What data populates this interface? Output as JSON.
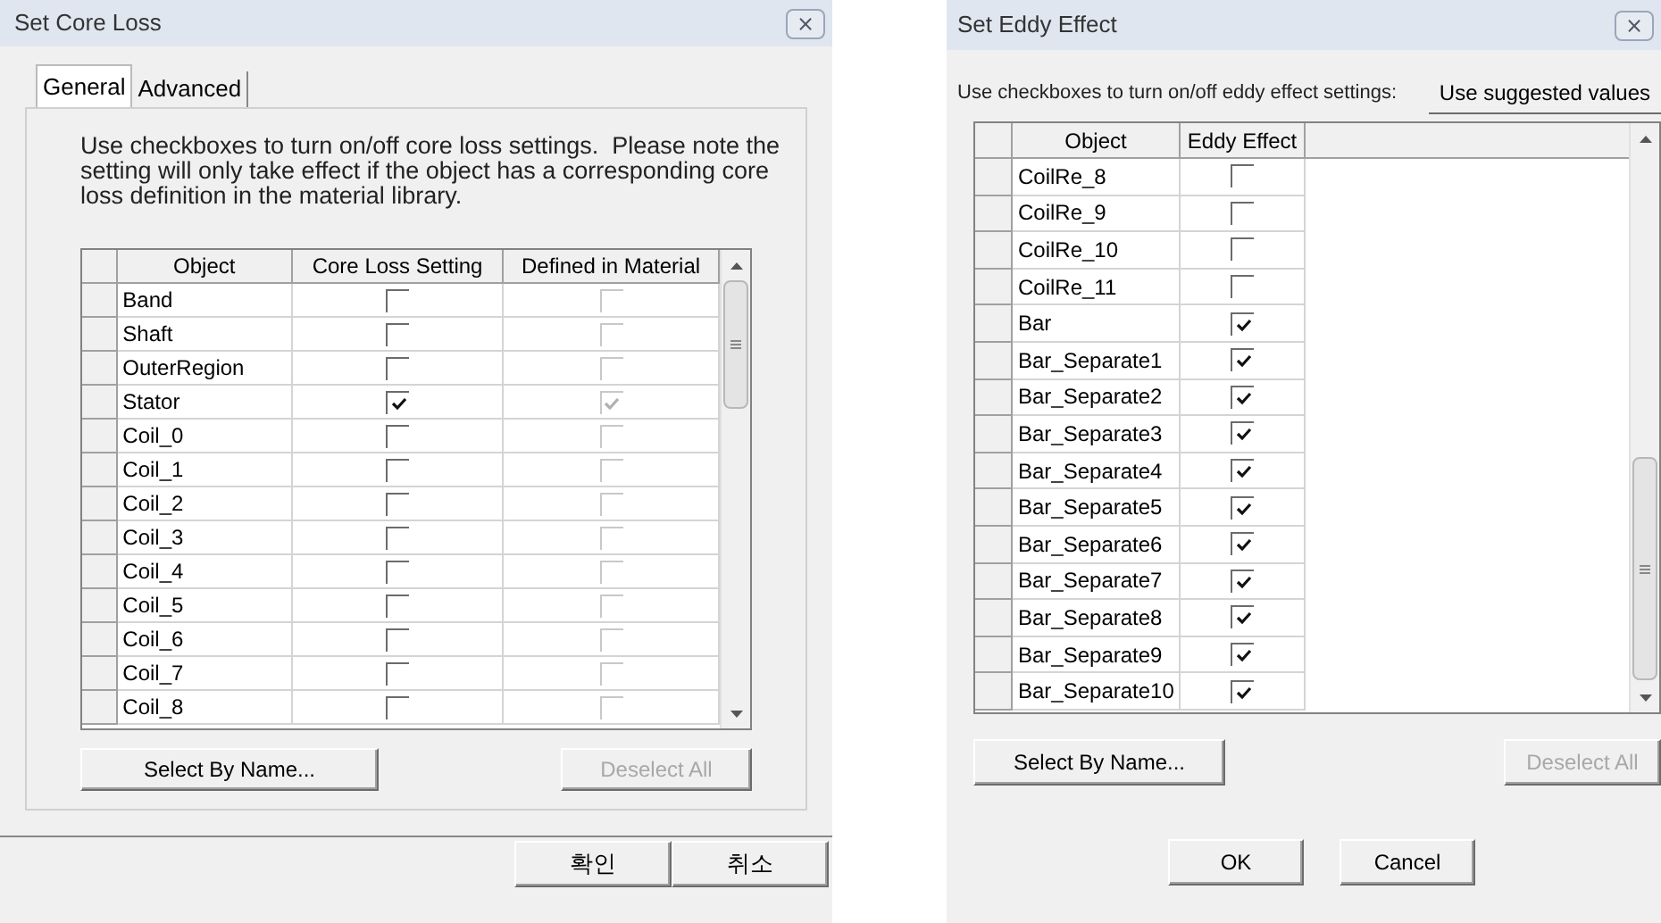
{
  "core_loss_dialog": {
    "title": "Set Core Loss",
    "close": "⨯",
    "tabs": [
      {
        "label": "General",
        "selected": true
      },
      {
        "label": "Advanced",
        "selected": false
      }
    ],
    "instructions": "Use checkboxes to turn on/off core loss settings.  Please note the setting will only take effect if the object has a corresponding core loss definition in the material library.",
    "table": {
      "columns": [
        {
          "label": "Object",
          "kind": "text"
        },
        {
          "label": "Core Loss Setting",
          "kind": "checkbox",
          "disabled": false
        },
        {
          "label": "Defined in Material",
          "kind": "checkbox",
          "disabled": true
        }
      ],
      "rows": [
        {
          "object": "Band",
          "checks": [
            {
              "checked": false
            },
            {
              "checked": false
            }
          ]
        },
        {
          "object": "Shaft",
          "checks": [
            {
              "checked": false
            },
            {
              "checked": false
            }
          ]
        },
        {
          "object": "OuterRegion",
          "checks": [
            {
              "checked": false
            },
            {
              "checked": false
            }
          ]
        },
        {
          "object": "Stator",
          "checks": [
            {
              "checked": true
            },
            {
              "checked": true
            }
          ]
        },
        {
          "object": "Coil_0",
          "checks": [
            {
              "checked": false
            },
            {
              "checked": false
            }
          ]
        },
        {
          "object": "Coil_1",
          "checks": [
            {
              "checked": false
            },
            {
              "checked": false
            }
          ]
        },
        {
          "object": "Coil_2",
          "checks": [
            {
              "checked": false
            },
            {
              "checked": false
            }
          ]
        },
        {
          "object": "Coil_3",
          "checks": [
            {
              "checked": false
            },
            {
              "checked": false
            }
          ]
        },
        {
          "object": "Coil_4",
          "checks": [
            {
              "checked": false
            },
            {
              "checked": false
            }
          ]
        },
        {
          "object": "Coil_5",
          "checks": [
            {
              "checked": false
            },
            {
              "checked": false
            }
          ]
        },
        {
          "object": "Coil_6",
          "checks": [
            {
              "checked": false
            },
            {
              "checked": false
            }
          ]
        },
        {
          "object": "Coil_7",
          "checks": [
            {
              "checked": false
            },
            {
              "checked": false
            }
          ]
        },
        {
          "object": "Coil_8",
          "checks": [
            {
              "checked": false
            },
            {
              "checked": false
            }
          ]
        }
      ]
    },
    "buttons": [
      {
        "label": "Select By Name...",
        "disabled": false
      },
      {
        "label": "Deselect All",
        "disabled": true
      }
    ],
    "footer_buttons": [
      {
        "label": "확인"
      },
      {
        "label": "취소"
      }
    ]
  },
  "eddy_dialog": {
    "title": "Set Eddy Effect",
    "close": "⨯",
    "instructions": "Use checkboxes to turn on/off eddy effect settings:",
    "suggest_button": "Use suggested values",
    "table": {
      "columns": [
        {
          "label": "Object",
          "kind": "text"
        },
        {
          "label": "Eddy Effect",
          "kind": "checkbox",
          "disabled": false
        }
      ],
      "rows": [
        {
          "object": "CoilRe_8",
          "checks": [
            {
              "checked": false
            }
          ]
        },
        {
          "object": "CoilRe_9",
          "checks": [
            {
              "checked": false
            }
          ]
        },
        {
          "object": "CoilRe_10",
          "checks": [
            {
              "checked": false
            }
          ]
        },
        {
          "object": "CoilRe_11",
          "checks": [
            {
              "checked": false
            }
          ]
        },
        {
          "object": "Bar",
          "checks": [
            {
              "checked": true
            }
          ]
        },
        {
          "object": "Bar_Separate1",
          "checks": [
            {
              "checked": true
            }
          ]
        },
        {
          "object": "Bar_Separate2",
          "checks": [
            {
              "checked": true
            }
          ]
        },
        {
          "object": "Bar_Separate3",
          "checks": [
            {
              "checked": true
            }
          ]
        },
        {
          "object": "Bar_Separate4",
          "checks": [
            {
              "checked": true
            }
          ]
        },
        {
          "object": "Bar_Separate5",
          "checks": [
            {
              "checked": true
            }
          ]
        },
        {
          "object": "Bar_Separate6",
          "checks": [
            {
              "checked": true
            }
          ]
        },
        {
          "object": "Bar_Separate7",
          "checks": [
            {
              "checked": true
            }
          ]
        },
        {
          "object": "Bar_Separate8",
          "checks": [
            {
              "checked": true
            }
          ]
        },
        {
          "object": "Bar_Separate9",
          "checks": [
            {
              "checked": true
            }
          ]
        },
        {
          "object": "Bar_Separate10",
          "checks": [
            {
              "checked": true
            }
          ]
        }
      ]
    },
    "buttons": [
      {
        "label": "Select By Name...",
        "disabled": false
      },
      {
        "label": "Deselect All",
        "disabled": true
      }
    ],
    "footer_buttons": [
      {
        "label": "OK"
      },
      {
        "label": "Cancel"
      }
    ]
  }
}
